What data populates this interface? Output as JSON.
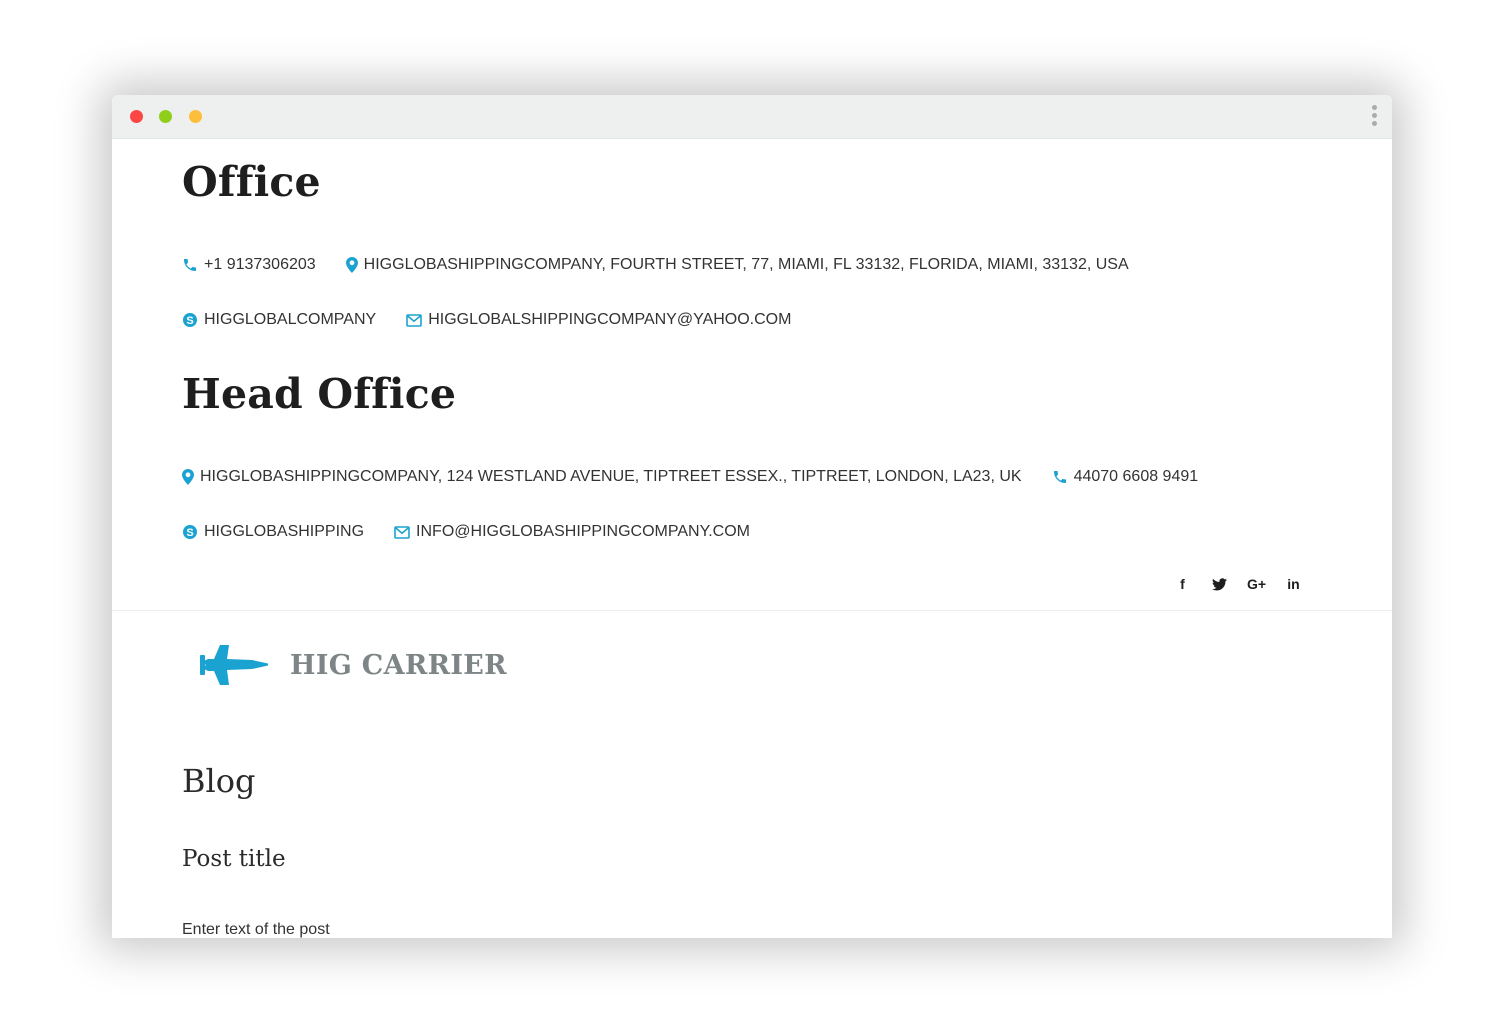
{
  "colors": {
    "accent": "#1aa3d0",
    "heading": "#1e1e1e",
    "logo_text": "#7e8587"
  },
  "office": {
    "title": "Office",
    "phone": "+1 9137306203",
    "address": "HIGGLOBASHIPPINGCOMPANY, FOURTH STREET, 77, MIAMI, FL 33132, FLORIDA, MIAMI, 33132, USA",
    "skype": "HIGGLOBALCOMPANY",
    "email": "HIGGLOBALSHIPPINGCOMPANY@YAHOO.COM"
  },
  "head_office": {
    "title": "Head Office",
    "address": "HIGGLOBASHIPPINGCOMPANY, 124 WESTLAND AVENUE, TIPTREET ESSEX., TIPTREET, LONDON, LA23, UK",
    "phone": "44070 6608 9491",
    "skype": "HIGGLOBASHIPPING",
    "email": "INFO@HIGGLOBASHIPPINGCOMPANY.COM"
  },
  "social": {
    "facebook": "f",
    "twitter": "twitter-icon",
    "googleplus": "G+",
    "linkedin": "in"
  },
  "logo": {
    "text": "HIG CARRIER",
    "icon": "jet-icon"
  },
  "blog": {
    "heading": "Blog",
    "post_title": "Post title",
    "post_text": "Enter text of the post"
  }
}
